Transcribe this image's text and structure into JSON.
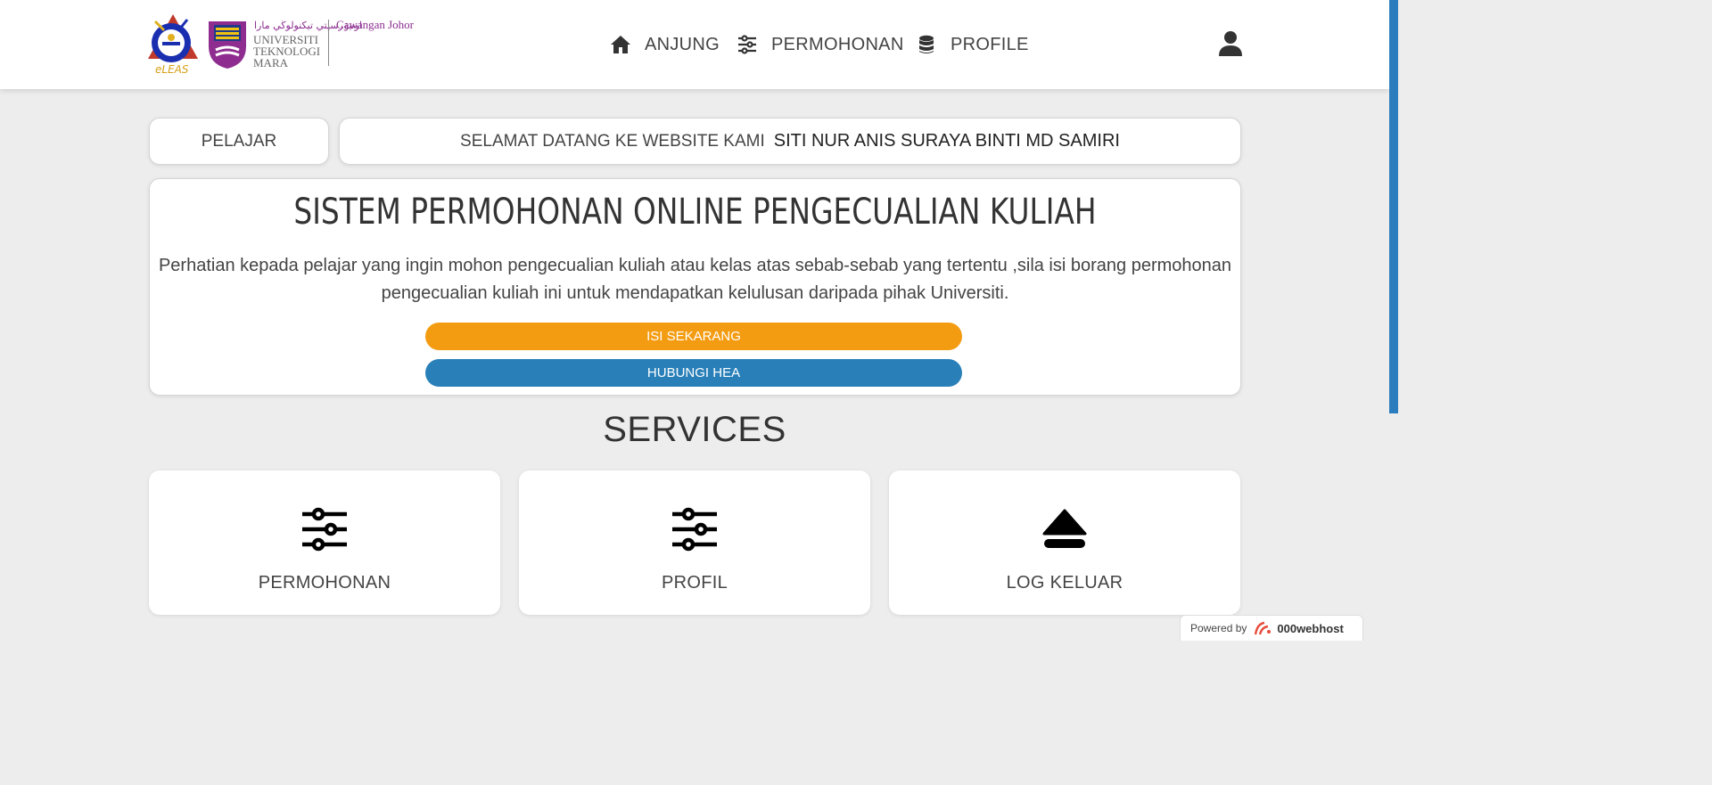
{
  "header": {
    "logo_text": "eLEAS",
    "uitm_arabic": "اونيۏرسيتي تيكنولوڬي مارا",
    "uitm_lines": [
      "UNIVERSITI",
      "TEKNOLOGI",
      "MARA"
    ],
    "campus": "Cawangan Johor",
    "nav": [
      {
        "label": "ANJUNG",
        "icon": "home-icon"
      },
      {
        "label": "PERMOHONAN",
        "icon": "sliders-icon"
      },
      {
        "label": "PROFILE",
        "icon": "database-icon"
      }
    ],
    "user_icon": "user-icon"
  },
  "status": {
    "role": "PELAJAR",
    "welcome_prefix": "SELAMAT DATANG KE WEBSITE KAMI",
    "user_name": "SITI NUR ANIS SURAYA BINTI MD SAMIRI"
  },
  "main": {
    "title": "SISTEM PERMOHONAN ONLINE PENGECUALIAN KULIAH",
    "description": "Perhatian kepada pelajar yang ingin mohon pengecualian kuliah atau kelas atas sebab-sebab yang tertentu ,sila isi borang permohonan pengecualian kuliah ini untuk mendapatkan kelulusan daripada pihak Universiti.",
    "fill_button": "ISI SEKARANG",
    "contact_button": "HUBUNGI HEA"
  },
  "services": {
    "title": "SERVICES",
    "items": [
      {
        "label": "PERMOHONAN",
        "icon": "sliders-icon"
      },
      {
        "label": "PROFIL",
        "icon": "sliders-icon"
      },
      {
        "label": "LOG KELUAR",
        "icon": "eject-icon"
      }
    ]
  },
  "footer_badge": {
    "prefix": "Powered by",
    "brand": "000webhost"
  },
  "colors": {
    "fill_button": "#f39c12",
    "contact_button": "#2980b9",
    "scrollbar": "#2b7dbe",
    "uitm_purple": "#8b2c8f"
  }
}
